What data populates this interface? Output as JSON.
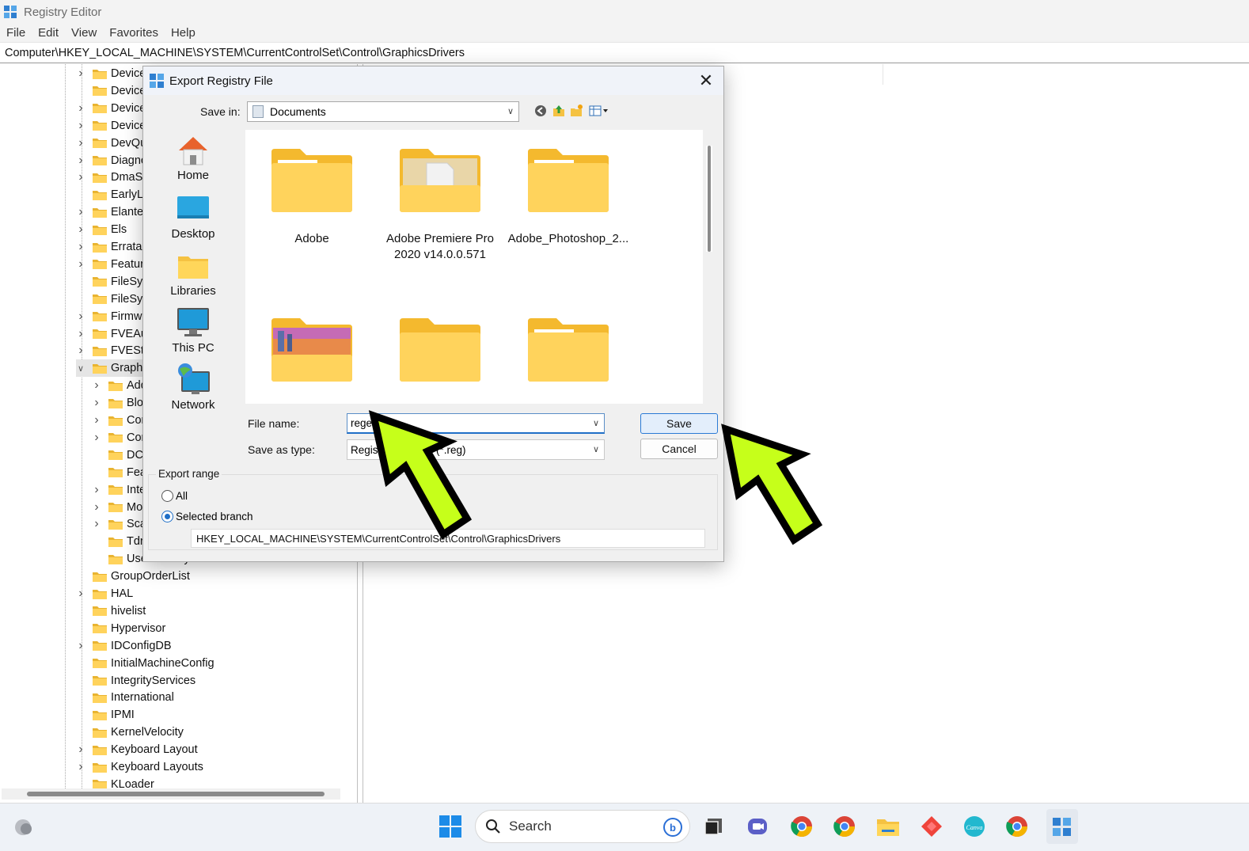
{
  "window": {
    "title": "Registry Editor",
    "menu": [
      "File",
      "Edit",
      "View",
      "Favorites",
      "Help"
    ],
    "address": "Computer\\HKEY_LOCAL_MACHINE\\SYSTEM\\CurrentControlSet\\Control\\GraphicsDrivers"
  },
  "tree": {
    "items": [
      {
        "label": "DeviceClasses",
        "level": 1,
        "expander": ">"
      },
      {
        "label": "DeviceContainerPropertyUpdateEvents",
        "level": 1,
        "expander": ""
      },
      {
        "label": "DeviceContainers",
        "level": 1,
        "expander": ">"
      },
      {
        "label": "DeviceGuard",
        "level": 1,
        "expander": ">"
      },
      {
        "label": "DevQuery",
        "level": 1,
        "expander": ">"
      },
      {
        "label": "Diagnostics",
        "level": 1,
        "expander": ">"
      },
      {
        "label": "DmaSecurity",
        "level": 1,
        "expander": ">"
      },
      {
        "label": "EarlyLaunch",
        "level": 1,
        "expander": ""
      },
      {
        "label": "Elantech",
        "level": 1,
        "expander": ">"
      },
      {
        "label": "Els",
        "level": 1,
        "expander": ">"
      },
      {
        "label": "Errata",
        "level": 1,
        "expander": ">"
      },
      {
        "label": "FeatureManagement",
        "level": 1,
        "expander": ">"
      },
      {
        "label": "FileSystem",
        "level": 1,
        "expander": ""
      },
      {
        "label": "FileSystemUtilities",
        "level": 1,
        "expander": ""
      },
      {
        "label": "Firmware",
        "level": 1,
        "expander": ">"
      },
      {
        "label": "FVEAutoUnlock",
        "level": 1,
        "expander": ">"
      },
      {
        "label": "FVEStats",
        "level": 1,
        "expander": ">"
      },
      {
        "label": "GraphicsDrivers",
        "level": 1,
        "expander": "v",
        "selected": true
      },
      {
        "label": "AdditionalModeLists",
        "level": 2,
        "expander": ">"
      },
      {
        "label": "BlockList",
        "level": 2,
        "expander": ">"
      },
      {
        "label": "Configuration",
        "level": 2,
        "expander": ">"
      },
      {
        "label": "Connectivity",
        "level": 2,
        "expander": ">"
      },
      {
        "label": "DCI",
        "level": 2,
        "expander": ""
      },
      {
        "label": "FeatureSetUsage",
        "level": 2,
        "expander": ""
      },
      {
        "label": "InternalMonitorEdid",
        "level": 2,
        "expander": ">"
      },
      {
        "label": "MonitorDataStore",
        "level": 2,
        "expander": ">"
      },
      {
        "label": "ScaleFactors",
        "level": 2,
        "expander": ">"
      },
      {
        "label": "TdrWatch",
        "level": 2,
        "expander": ""
      },
      {
        "label": "UseNewKey",
        "level": 2,
        "expander": ""
      },
      {
        "label": "GroupOrderList",
        "level": 1,
        "expander": ""
      },
      {
        "label": "HAL",
        "level": 1,
        "expander": ">"
      },
      {
        "label": "hivelist",
        "level": 1,
        "expander": ""
      },
      {
        "label": "Hypervisor",
        "level": 1,
        "expander": ""
      },
      {
        "label": "IDConfigDB",
        "level": 1,
        "expander": ">"
      },
      {
        "label": "InitialMachineConfig",
        "level": 1,
        "expander": ""
      },
      {
        "label": "IntegrityServices",
        "level": 1,
        "expander": ""
      },
      {
        "label": "International",
        "level": 1,
        "expander": ""
      },
      {
        "label": "IPMI",
        "level": 1,
        "expander": ""
      },
      {
        "label": "KernelVelocity",
        "level": 1,
        "expander": ""
      },
      {
        "label": "Keyboard Layout",
        "level": 1,
        "expander": ">"
      },
      {
        "label": "Keyboard Layouts",
        "level": 1,
        "expander": ">"
      },
      {
        "label": "KLoader",
        "level": 1,
        "expander": ""
      }
    ]
  },
  "dialog": {
    "title": "Export Registry File",
    "close_glyph": "✕",
    "save_in_label": "Save in:",
    "save_in_value": "Documents",
    "places": [
      "Home",
      "Desktop",
      "Libraries",
      "This PC",
      "Network"
    ],
    "files": [
      {
        "name": "Adobe",
        "kind": "folder"
      },
      {
        "name": "Adobe Premiere Pro 2020 v14.0.0.571",
        "kind": "folder-doc"
      },
      {
        "name": "Adobe_Photoshop_2...",
        "kind": "folder"
      },
      {
        "name": "",
        "kind": "folder-image"
      },
      {
        "name": "",
        "kind": "folder"
      },
      {
        "name": "",
        "kind": "folder"
      }
    ],
    "file_name_label": "File name:",
    "file_name_value": "regedit",
    "save_as_type_label": "Save as type:",
    "save_as_type_value": "Registration Files (*.reg)",
    "save_button": "Save",
    "cancel_button": "Cancel",
    "export_range_label": "Export range",
    "radio_all": "All",
    "radio_selected": "Selected branch",
    "selected_option": "Selected branch",
    "branch_value": "HKEY_LOCAL_MACHINE\\SYSTEM\\CurrentControlSet\\Control\\GraphicsDrivers"
  },
  "taskbar": {
    "search_label": "Search",
    "apps": [
      "start-icon",
      "search-icon",
      "bing-icon",
      "task-view-icon",
      "teams-icon",
      "chrome-icon",
      "chrome-icon",
      "file-explorer-icon",
      "anydesk-icon",
      "canva-icon",
      "chrome-icon",
      "regedit-icon"
    ]
  },
  "annotations": {
    "arrow_color": "#c6ff1a"
  }
}
